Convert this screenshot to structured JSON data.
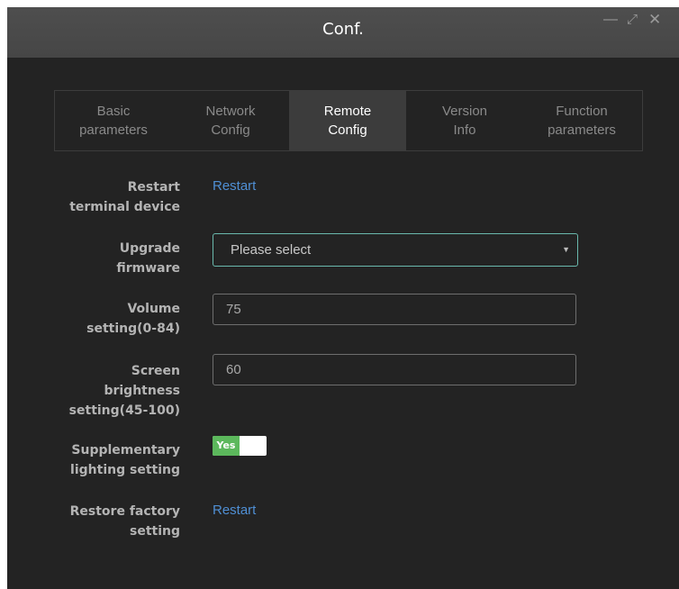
{
  "window": {
    "title": "Conf.",
    "controls": {
      "minimize": "—",
      "maximize": "⤢",
      "close": "✕"
    }
  },
  "tabs": [
    {
      "line1": "Basic",
      "line2": "parameters",
      "active": false
    },
    {
      "line1": "Network",
      "line2": "Config",
      "active": false
    },
    {
      "line1": "Remote",
      "line2": "Config",
      "active": true
    },
    {
      "line1": "Version",
      "line2": "Info",
      "active": false
    },
    {
      "line1": "Function",
      "line2": "parameters",
      "active": false
    }
  ],
  "form": {
    "restart_terminal": {
      "label_line1": "Restart",
      "label_line2": "terminal device",
      "action": "Restart"
    },
    "upgrade_firmware": {
      "label_line1": "Upgrade",
      "label_line2": "firmware",
      "selected": "Please select"
    },
    "volume": {
      "label_line1": "Volume",
      "label_line2": "setting(0-84)",
      "value": "75"
    },
    "brightness": {
      "label_line1": "Screen",
      "label_line2": "brightness",
      "label_line3": "setting(45-100)",
      "value": "60"
    },
    "supplementary_lighting": {
      "label_line1": "Supplementary",
      "label_line2": "lighting setting",
      "toggle_label": "Yes",
      "enabled": true
    },
    "restore_factory": {
      "label_line1": "Restore factory",
      "label_line2": "setting",
      "action": "Restart"
    }
  },
  "colors": {
    "background": "#232323",
    "titlebar": "#4a4a4a",
    "active_tab": "#3c3c3c",
    "link": "#4f8fd4",
    "select_border": "#6ab9ad",
    "toggle_on": "#5cb85c"
  },
  "icons": {
    "select_caret": "caret-down-icon"
  }
}
